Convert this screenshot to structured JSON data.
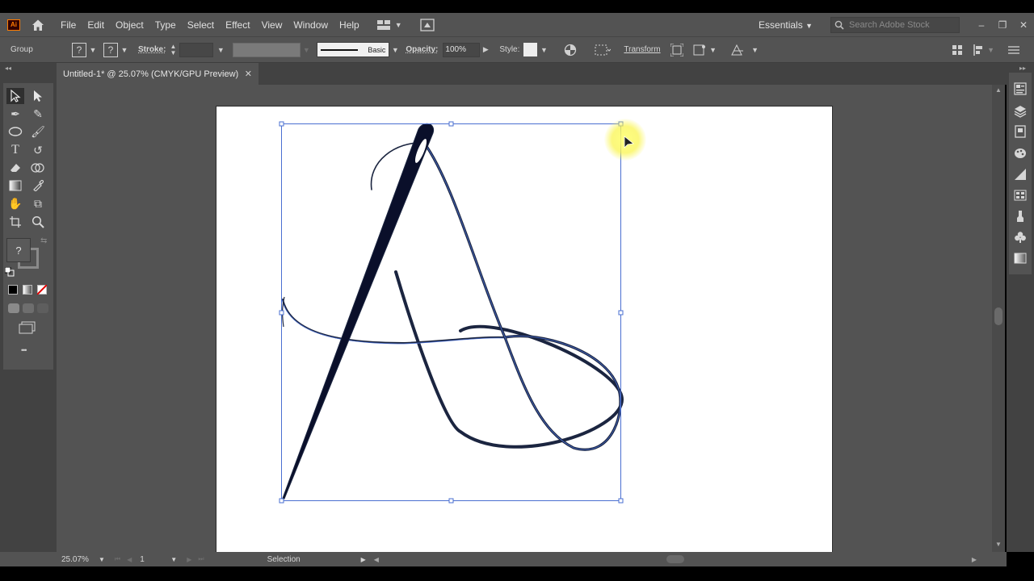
{
  "app": {
    "logo_text": "Ai",
    "menu": [
      "File",
      "Edit",
      "Object",
      "Type",
      "Select",
      "Effect",
      "View",
      "Window",
      "Help"
    ],
    "workspace": "Essentials",
    "stock_search_placeholder": "Search Adobe Stock"
  },
  "control_bar": {
    "selection_type": "Group",
    "fill_unknown": "?",
    "stroke_unknown": "?",
    "stroke_label": "Stroke:",
    "brush_name": "Basic",
    "opacity_label": "Opacity:",
    "opacity_value": "100%",
    "style_label": "Style:",
    "transform_label": "Transform"
  },
  "document": {
    "tab_title": "Untitled-1* @ 25.07% (CMYK/GPU Preview)",
    "close_glyph": "✕"
  },
  "tools": {
    "fillstroke_unknown": "?",
    "more_glyph": "•••"
  },
  "status": {
    "zoom": "25.07%",
    "artboard_number": "1",
    "current_tool": "Selection"
  },
  "colors": {
    "ui_bg": "#535353",
    "ui_dark": "#424242",
    "stroke_navy": "#1b2540",
    "selection_blue": "#4a6fd1",
    "cursor_highlight": "#f7f07a"
  },
  "icons": [
    "home-icon",
    "workspace-switcher-icon",
    "search-icon",
    "selection-tool-icon",
    "direct-selection-tool-icon",
    "pen-tool-icon",
    "curvature-tool-icon",
    "ellipse-tool-icon",
    "paintbrush-tool-icon",
    "type-tool-icon",
    "rotate-tool-icon",
    "eraser-tool-icon",
    "shape-builder-icon",
    "gradient-tool-icon",
    "eyedropper-tool-icon",
    "puppet-warp-icon",
    "symbol-sprayer-icon",
    "artboard-tool-icon",
    "zoom-tool-icon",
    "properties-panel-icon",
    "layers-panel-icon",
    "libraries-panel-icon",
    "color-panel-icon",
    "color-guide-icon",
    "swatches-panel-icon",
    "brushes-panel-icon",
    "symbols-panel-icon",
    "gradient-panel-icon"
  ]
}
